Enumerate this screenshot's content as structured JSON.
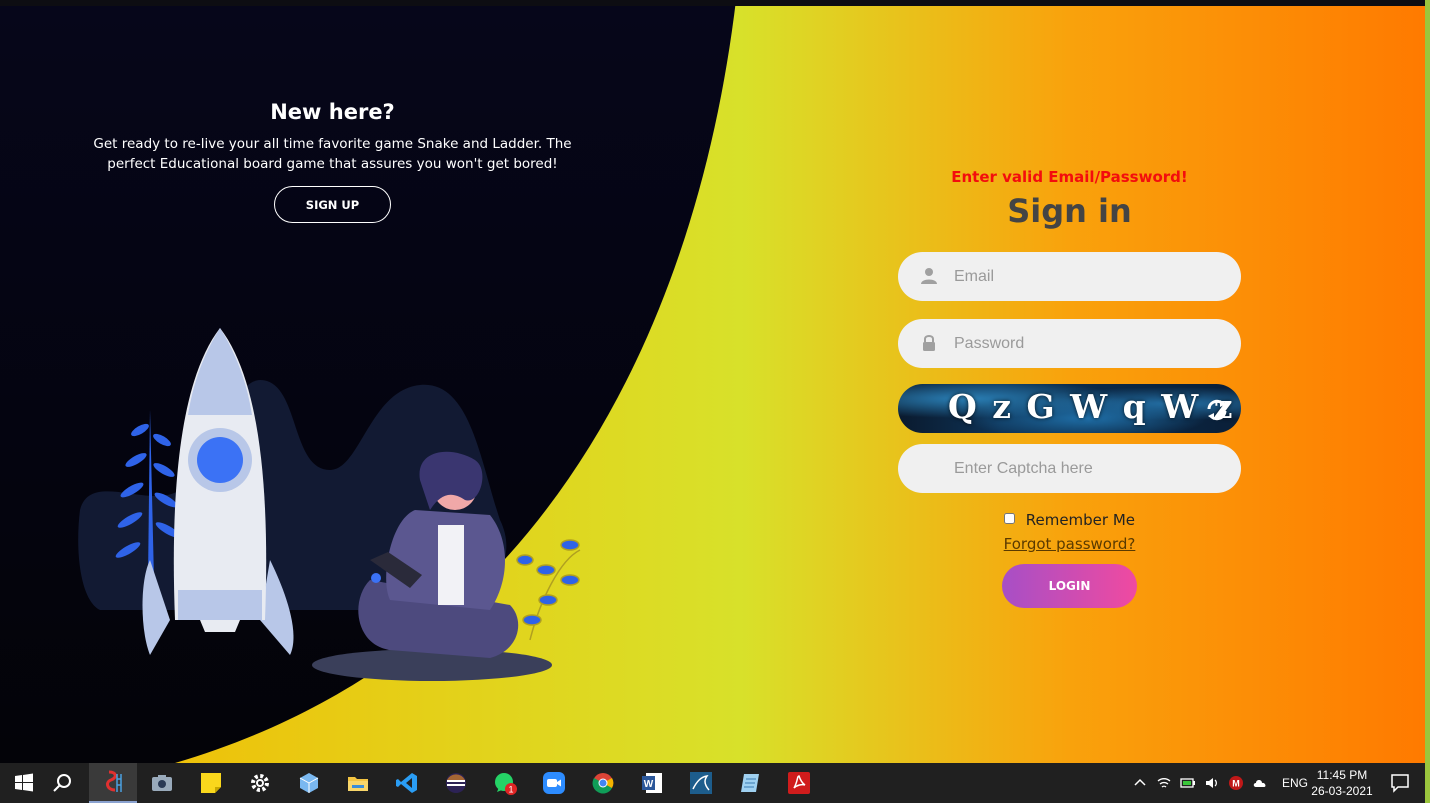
{
  "left_panel": {
    "title": "New here?",
    "description": "Get ready to re-live your all time favorite game Snake and Ladder. The perfect Educational board game that assures you won't get bored!",
    "signup_label": "SIGN UP"
  },
  "login_form": {
    "error_message": "Enter valid Email/Password!",
    "title": "Sign in",
    "email_placeholder": "Email",
    "password_placeholder": "Password",
    "captcha_text": "QzGWqWz",
    "captcha_placeholder": "Enter Captcha here",
    "remember_label": "Remember Me",
    "remember_checked": false,
    "forgot_label": "Forgot password?",
    "login_label": "LOGIN"
  },
  "colors": {
    "error": "#f30d0d",
    "title": "#444444",
    "login_gradient_start": "#a74fc6",
    "login_gradient_end": "#f04aa0",
    "dark_panel": "#05050f"
  },
  "taskbar": {
    "apps": [
      {
        "name": "start-icon"
      },
      {
        "name": "search-icon"
      },
      {
        "name": "snake-ladder-app-icon",
        "active": true
      },
      {
        "name": "camera-icon"
      },
      {
        "name": "sticky-notes-icon"
      },
      {
        "name": "settings-gear-icon"
      },
      {
        "name": "3d-box-icon"
      },
      {
        "name": "file-explorer-icon"
      },
      {
        "name": "vscode-icon"
      },
      {
        "name": "eclipse-icon"
      },
      {
        "name": "whatsapp-icon",
        "badge": "1"
      },
      {
        "name": "zoom-icon"
      },
      {
        "name": "chrome-icon"
      },
      {
        "name": "word-icon"
      },
      {
        "name": "mysql-icon"
      },
      {
        "name": "notepad-icon"
      },
      {
        "name": "acrobat-icon"
      }
    ],
    "language": "ENG",
    "time": "11:45 PM",
    "date": "26-03-2021"
  }
}
